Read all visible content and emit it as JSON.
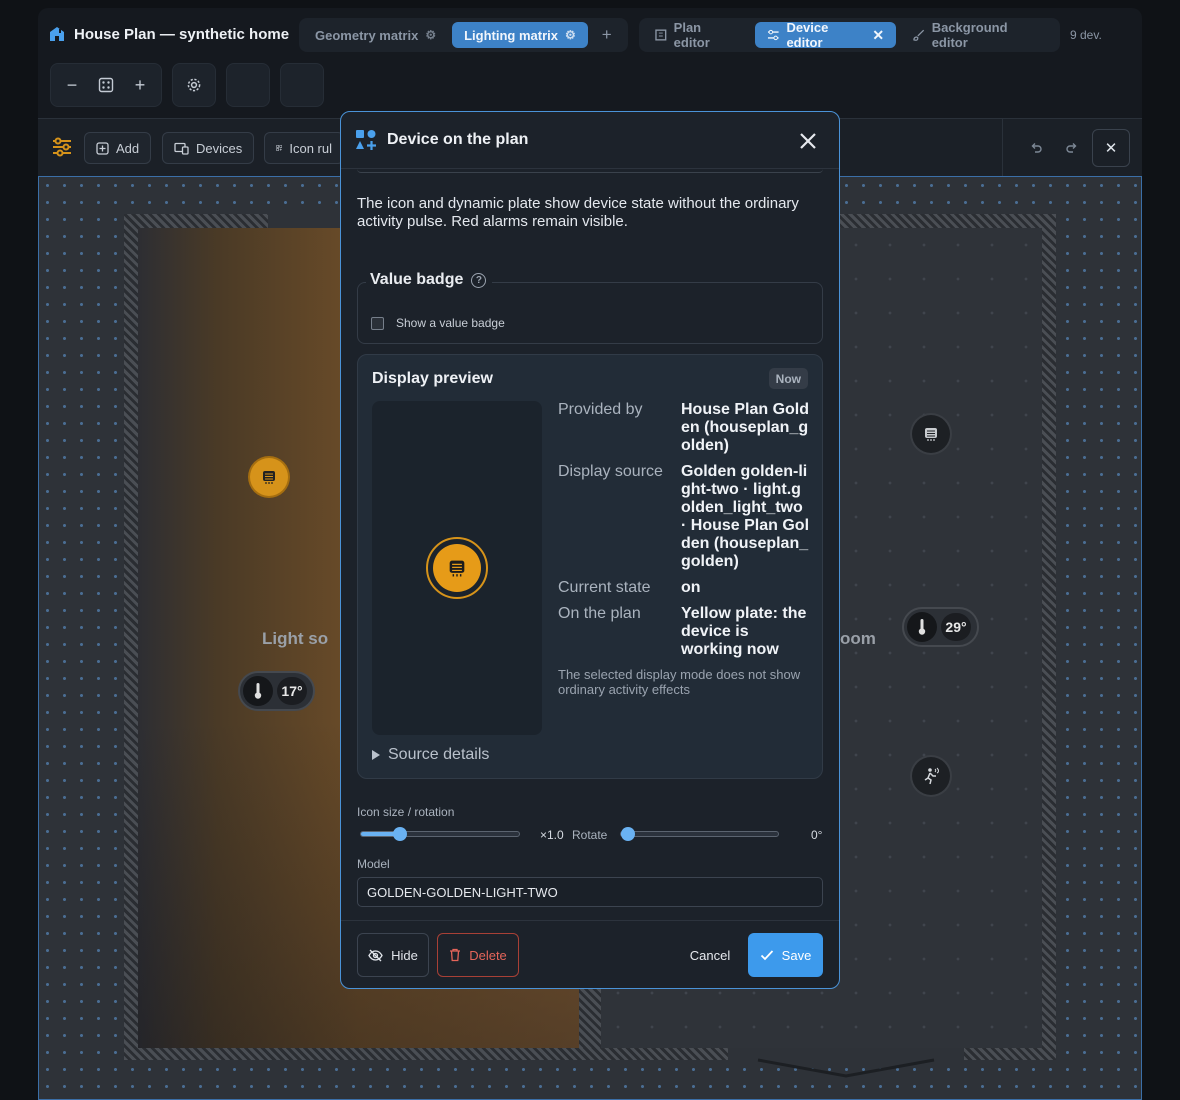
{
  "header": {
    "title": "House Plan — synthetic home",
    "tabs": [
      {
        "label": "Geometry matrix",
        "active": false
      },
      {
        "label": "Lighting matrix",
        "active": true
      }
    ],
    "editor_tabs": [
      {
        "label": "Plan editor",
        "active": false
      },
      {
        "label": "Device editor",
        "active": true
      },
      {
        "label": "Background editor",
        "active": false
      }
    ],
    "device_count": "9 dev.",
    "icons": [
      "house-icon",
      "gear-icon",
      "plus-icon",
      "plan-icon",
      "sliders-icon",
      "close-icon",
      "brush-icon"
    ]
  },
  "zoom": {
    "icons": [
      "minus-icon",
      "fit-icon",
      "plus-icon",
      "gear-icon"
    ]
  },
  "toolbar": {
    "add_label": "Add",
    "devices_label": "Devices",
    "icon_rules_label": "Icon rul",
    "icons": [
      "filters-icon",
      "add-icon",
      "devices-icon",
      "icon-rules-icon",
      "undo-icon",
      "redo-icon",
      "close-icon"
    ]
  },
  "plan": {
    "left_room_label": "Light so",
    "right_room_label": "oom",
    "temp_left": "17°",
    "temp_right": "29°",
    "icons": [
      "light-icon",
      "thermometer-icon",
      "motion-icon"
    ]
  },
  "dialog": {
    "title": "Device on the plan",
    "description": "The icon and dynamic plate show device state without the ordinary activity pulse. Red alarms remain visible.",
    "value_badge": {
      "legend": "Value badge",
      "help": "?",
      "checkbox_label": "Show a value badge",
      "checked": false
    },
    "preview": {
      "title": "Display preview",
      "badge": "Now",
      "rows": [
        {
          "key": "Provided by",
          "value": "House Plan Golden (houseplan_golden)"
        },
        {
          "key": "Display source",
          "value": "Golden golden-light-two · light.golden_light_two · House Plan Golden (houseplan_golden)"
        },
        {
          "key": "Current state",
          "value": "on"
        },
        {
          "key": "On the plan",
          "value": "Yellow plate: the device is working now"
        }
      ],
      "note": "The selected display mode does not show ordinary activity effects",
      "details": "Source details"
    },
    "icon_size_label": "Icon size / rotation",
    "size_value": "×1.0",
    "size_fraction": 0.22,
    "rotate_label": "Rotate",
    "rotate_value": "0°",
    "rotate_fraction": 0,
    "model_label": "Model",
    "model_value": "GOLDEN-GOLDEN-LIGHT-TWO",
    "buttons": {
      "hide": "Hide",
      "delete": "Delete",
      "cancel": "Cancel",
      "save": "Save"
    },
    "colors": {
      "accent": "#3d9aec",
      "light_on": "#e69b18",
      "danger": "#e5655a"
    }
  }
}
